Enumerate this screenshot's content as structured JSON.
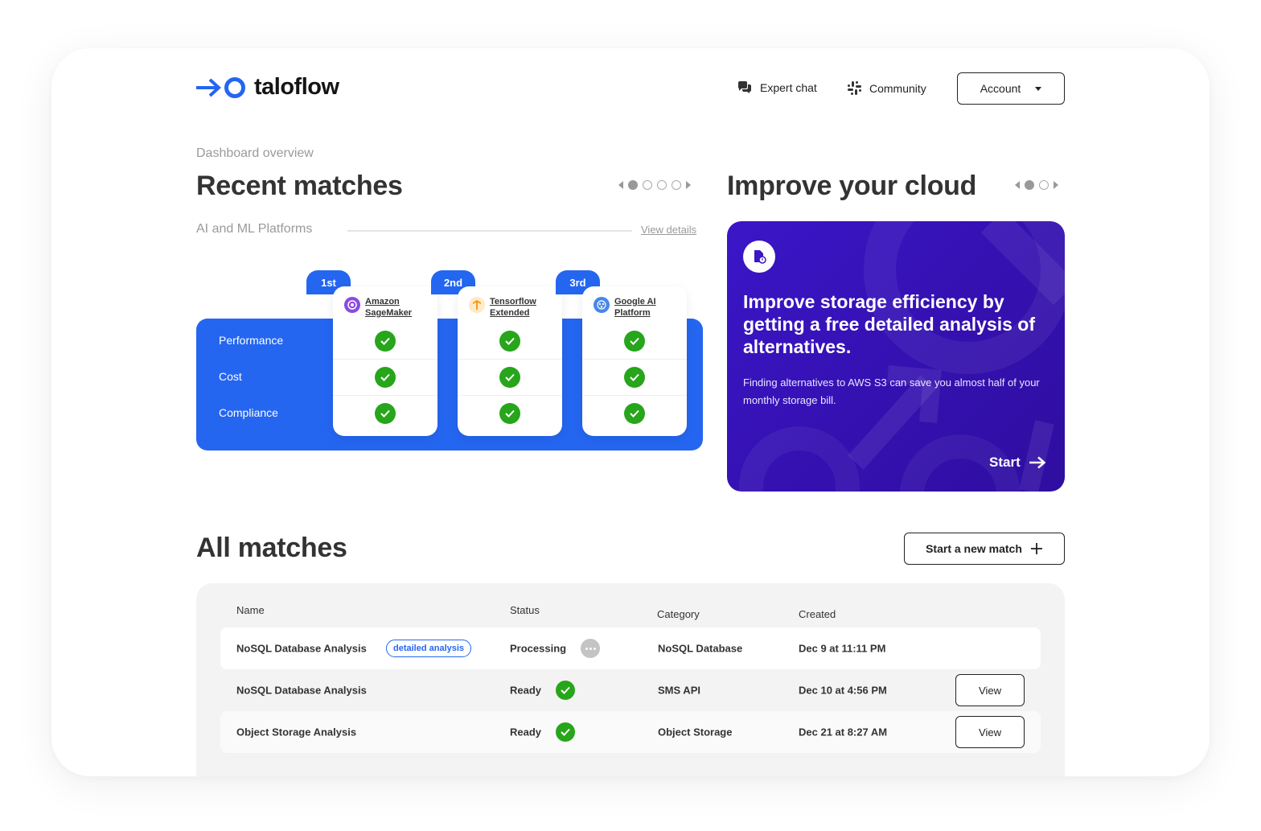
{
  "brand": {
    "name": "taloflow"
  },
  "nav": {
    "expert_chat": "Expert chat",
    "community": "Community",
    "account": "Account"
  },
  "overview": {
    "label": "Dashboard overview"
  },
  "recent": {
    "title": "Recent matches",
    "category": "AI and ML Platforms",
    "view_details": "View details",
    "rows": [
      "Performance",
      "Cost",
      "Compliance"
    ],
    "providers": [
      {
        "rank": "1st",
        "line1": "Amazon",
        "line2": "SageMaker",
        "icon": "sagemaker-icon"
      },
      {
        "rank": "2nd",
        "line1": "Tensorflow",
        "line2": "Extended",
        "icon": "tensorflow-icon"
      },
      {
        "rank": "3rd",
        "line1": "Google AI",
        "line2": "Platform",
        "icon": "google-ai-icon"
      }
    ]
  },
  "improve": {
    "title": "Improve your cloud",
    "card_title": "Improve storage efficiency by getting a free detailed analysis of alternatives.",
    "card_text": "Finding alternatives to AWS S3 can save you almost half of your monthly storage bill.",
    "start": "Start"
  },
  "all_matches": {
    "title": "All matches",
    "new_match": "Start a new match",
    "columns": {
      "name": "Name",
      "status": "Status",
      "category": "Category",
      "created": "Created"
    },
    "rows": [
      {
        "name": "NoSQL Database Analysis",
        "badge": "detailed analysis",
        "status": "Processing",
        "category": "NoSQL Database",
        "created": "Dec 9 at 11:11 PM"
      },
      {
        "name": "NoSQL Database Analysis",
        "status": "Ready",
        "category": "SMS API",
        "created": "Dec 10 at 4:56 PM",
        "action": "View"
      },
      {
        "name": "Object Storage Analysis",
        "status": "Ready",
        "category": "Object Storage",
        "created": "Dec 21 at 8:27 AM",
        "action": "View"
      }
    ]
  },
  "colors": {
    "accent": "#2466f0",
    "promo": "#3a16c8",
    "ready": "#27a51b"
  }
}
